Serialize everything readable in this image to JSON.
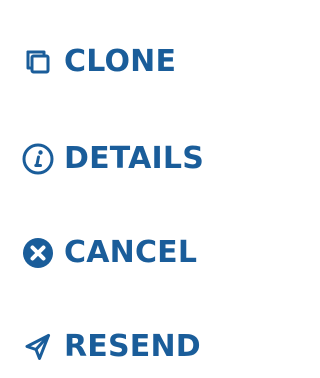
{
  "menu": {
    "items": [
      {
        "label": "CLONE",
        "icon": "copy-icon"
      },
      {
        "label": "DETAILS",
        "icon": "info-icon"
      },
      {
        "label": "CANCEL",
        "icon": "cancel-icon"
      },
      {
        "label": "RESEND",
        "icon": "send-icon"
      }
    ]
  },
  "colors": {
    "accent": "#1A5D9A",
    "background": "#FFFFFF"
  }
}
